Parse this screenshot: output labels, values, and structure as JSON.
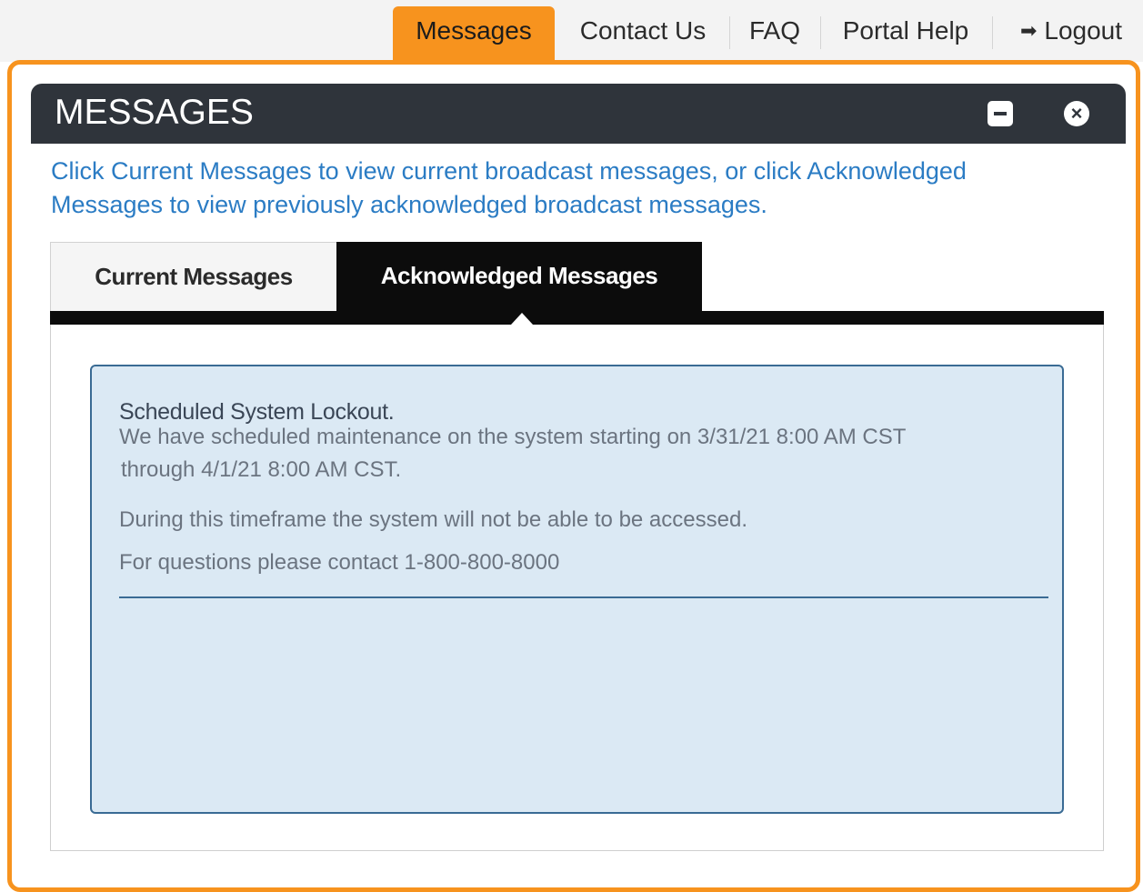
{
  "nav": {
    "messages": "Messages",
    "contact": "Contact Us",
    "faq": "FAQ",
    "help": "Portal Help",
    "logout": "Logout",
    "active_color": "#f7931e"
  },
  "panel": {
    "title": "MESSAGES",
    "intro_line1": "Click Current Messages to view current broadcast messages, or click Acknowledged",
    "intro_line2": "Messages to view previously acknowledged broadcast messages."
  },
  "tabs": {
    "current": "Current Messages",
    "acknowledged": "Acknowledged Messages",
    "active": "acknowledged"
  },
  "message": {
    "title": "Scheduled System Lockout.",
    "line1": "We have scheduled maintenance on the system starting on 3/31/21 8:00 AM CST",
    "line2": "through 4/1/21 8:00 AM CST.",
    "line3": "During this timeframe the system will not be able to be accessed.",
    "line4": "For questions please contact 1-800-800-8000"
  },
  "icons": {
    "logout": "logout-arrow-icon",
    "minimize": "minimize-icon",
    "close": "close-icon"
  }
}
